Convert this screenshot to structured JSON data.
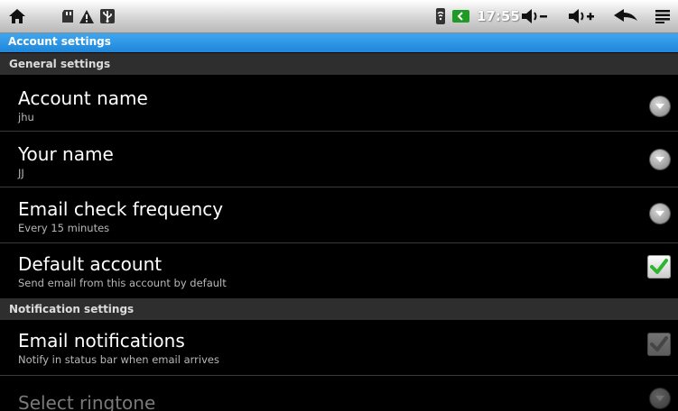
{
  "status_bar": {
    "time": "17:55",
    "icons": [
      "home-icon",
      "sd-card-icon",
      "warning-icon",
      "usb-icon",
      "wifi-icon",
      "battery-icon",
      "volume-down-icon",
      "volume-up-icon",
      "back-icon",
      "menu-icon"
    ]
  },
  "title_bar": {
    "title": "Account settings"
  },
  "sections": {
    "general": "General settings",
    "notification": "Notification settings"
  },
  "prefs": {
    "account_name": {
      "title": "Account name",
      "summary": "jhu"
    },
    "your_name": {
      "title": "Your name",
      "summary": "JJ"
    },
    "email_check_frequency": {
      "title": "Email check frequency",
      "summary": "Every 15 minutes"
    },
    "default_account": {
      "title": "Default account",
      "summary": "Send email from this account by default",
      "checked": true
    },
    "email_notifications": {
      "title": "Email notifications",
      "summary": "Notify in status bar when email arrives",
      "checked": true,
      "enabled": false
    },
    "select_ringtone": {
      "title": "Select ringtone",
      "enabled": false
    }
  },
  "colors": {
    "accent": "#2a93e3",
    "check_green": "#2fb52f",
    "section_bg": "#2e2e2e"
  }
}
